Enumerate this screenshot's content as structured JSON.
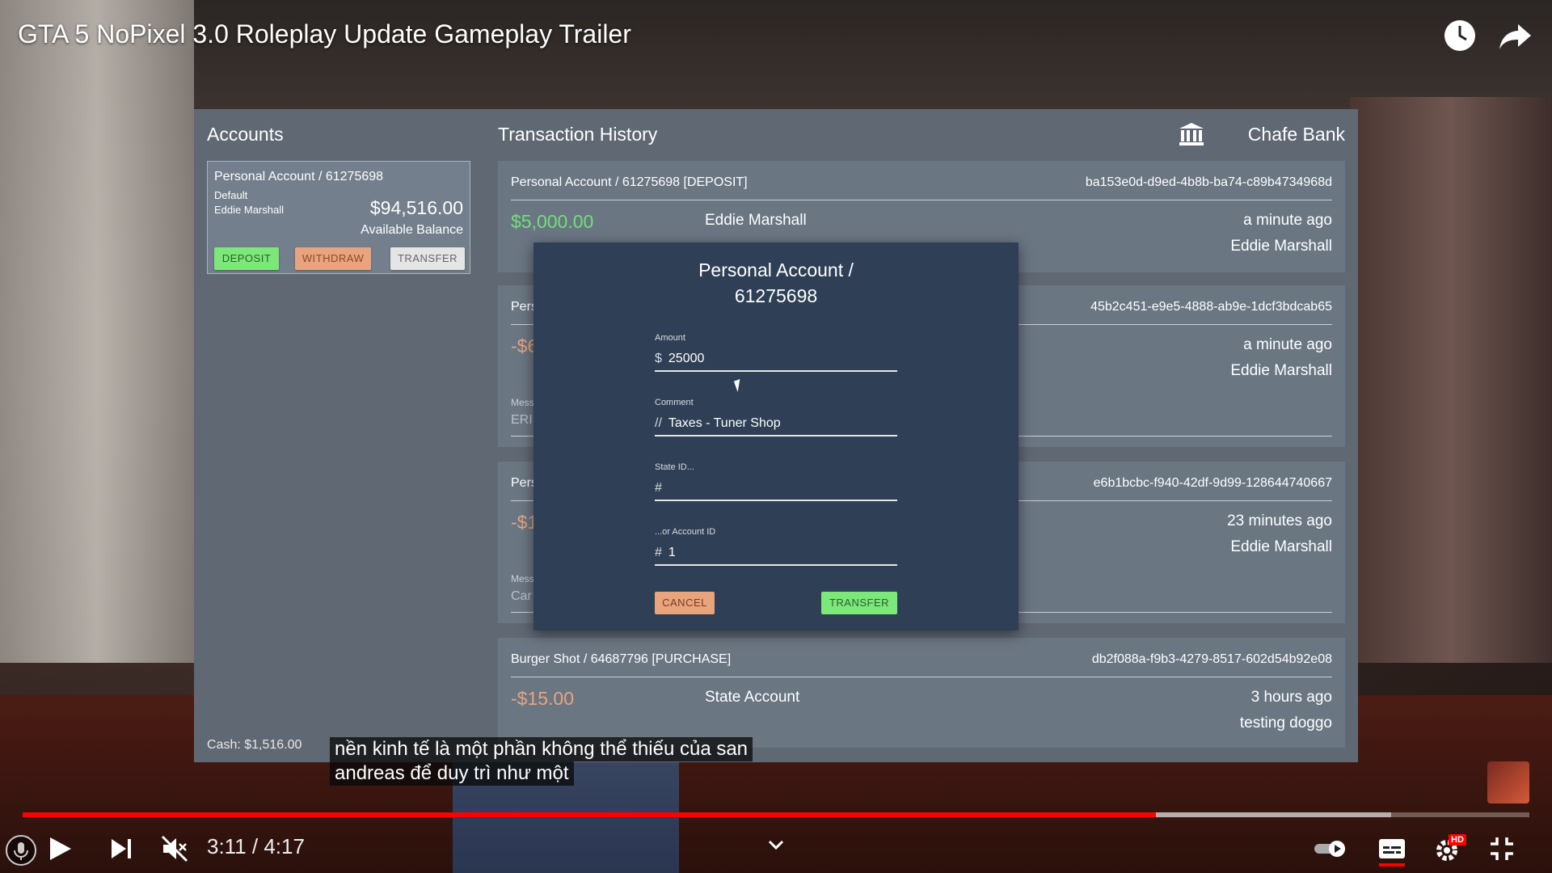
{
  "video": {
    "title": "GTA 5 NoPixel 3.0 Roleplay Update Gameplay Trailer",
    "time_display": "3:11 / 4:17",
    "progress_fraction": 0.752,
    "buffered_fraction": 0.908,
    "subtitles": [
      "nền kinh tế là một phần không thể thiếu của san",
      "andreas để duy trì như một"
    ],
    "hd_badge": "HD"
  },
  "bank": {
    "accounts_title": "Accounts",
    "history_title": "Transaction History",
    "bank_name": "Chafe Bank",
    "cash": "Cash: $1,516.00",
    "account": {
      "name": "Personal Account / 61275698",
      "default_label": "Default",
      "owner": "Eddie Marshall",
      "balance": "$94,516.00",
      "balance_label": "Available Balance",
      "deposit": "DEPOSIT",
      "withdraw": "WITHDRAW",
      "transfer": "TRANSFER"
    },
    "transactions": [
      {
        "head": "Personal Account / 61275698 [DEPOSIT]",
        "id": "ba153e0d-d9ed-4b8b-ba74-c89b4734968d",
        "amount": "$5,000.00",
        "party": "Eddie Marshall",
        "time": "a minute ago",
        "user": "Eddie Marshall"
      },
      {
        "head": "Pers",
        "id": "45b2c451-e9e5-4888-ab9e-1dcf3bdcab65",
        "amount": "-$6",
        "time": "a minute ago",
        "user": "Eddie Marshall",
        "msg_label": "Mess",
        "msg": "ERI"
      },
      {
        "head": "Pers",
        "id": "e6b1bcbc-f940-42df-9d99-128644740667",
        "amount": "-$1",
        "time": "23 minutes ago",
        "user": "Eddie Marshall",
        "msg_label": "Mess",
        "msg": "Car"
      },
      {
        "head": "Burger Shot / 64687796 [PURCHASE]",
        "id": "db2f088a-f9b3-4279-8517-602d54b92e08",
        "amount": "-$15.00",
        "party": "State Account",
        "time": "3 hours ago",
        "user": "testing doggo"
      }
    ]
  },
  "modal": {
    "title_line1": "Personal Account /",
    "title_line2": "61275698",
    "amount_label": "Amount",
    "amount_prefix": "$",
    "amount_value": "25000",
    "comment_label": "Comment",
    "comment_prefix": "//",
    "comment_value": "Taxes - Tuner Shop",
    "stateid_label": "State ID...",
    "stateid_prefix": "#",
    "stateid_value": "",
    "accountid_label": "...or Account ID",
    "accountid_prefix": "#",
    "accountid_value": "1",
    "cancel": "CANCEL",
    "transfer": "TRANSFER"
  },
  "colors": {
    "deposit_green": "#7ce87a",
    "withdraw_orange": "#e8a47c",
    "progress_red": "#ff0000"
  }
}
